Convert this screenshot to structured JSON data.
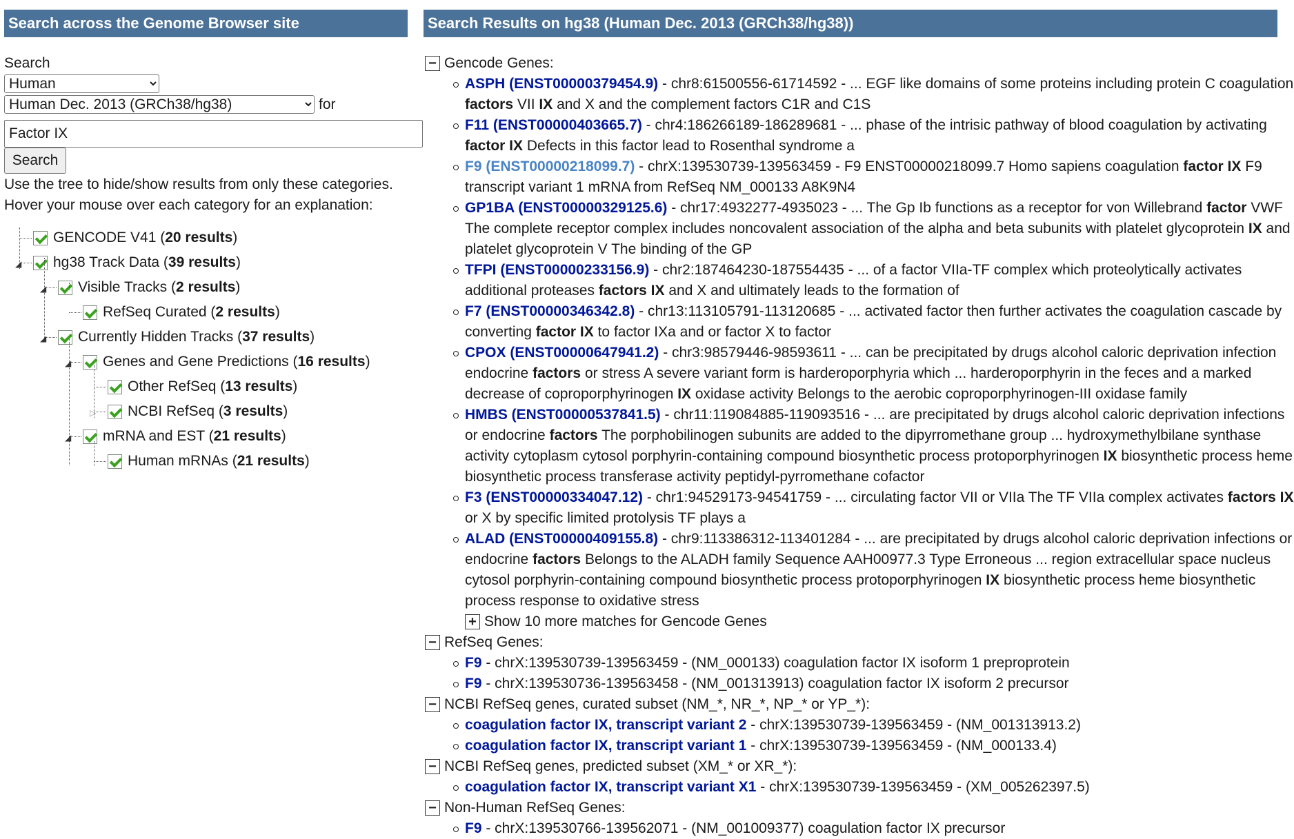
{
  "left_panel": {
    "header": "Search across the Genome Browser site",
    "search_label": "Search",
    "genome_select": "Human",
    "assembly_select": "Human Dec. 2013 (GRCh38/hg38)",
    "for_label": "for",
    "query_value": "Factor IX",
    "search_button": "Search",
    "help_line1": "Use the tree to hide/show results from only these categories.",
    "help_line2": "Hover your mouse over each category for an explanation:",
    "tree": [
      {
        "label": "GENCODE V41",
        "count": "20 results"
      },
      {
        "label": "hg38 Track Data",
        "count": "39 results"
      },
      {
        "label": "Visible Tracks",
        "count": "2 results"
      },
      {
        "label": "RefSeq Curated",
        "count": "2 results"
      },
      {
        "label": "Currently Hidden Tracks",
        "count": "37 results"
      },
      {
        "label": "Genes and Gene Predictions",
        "count": "16 results"
      },
      {
        "label": "Other RefSeq",
        "count": "13 results"
      },
      {
        "label": "NCBI RefSeq",
        "count": "3 results"
      },
      {
        "label": "mRNA and EST",
        "count": "21 results"
      },
      {
        "label": "Human mRNAs",
        "count": "21 results"
      }
    ]
  },
  "right_panel": {
    "header": "Search Results on hg38 (Human Dec. 2013 (GRCh38/hg38))",
    "categories": [
      {
        "title": "Gencode Genes:",
        "results": [
          {
            "link": "ASPH (ENST00000379454.9)",
            "rest_html": " - chr8:61500556-61714592 - ... EGF like domains of some proteins including protein C coagulation <b class=\"k\">factors</b> VII <b class=\"k\">IX</b> and X and the complement factors C1R and C1S"
          },
          {
            "link": "F11 (ENST00000403665.7)",
            "rest_html": " - chr4:186266189-186289681 - ... phase of the intrisic pathway of blood coagulation by activating <b class=\"k\">factor IX</b> Defects in this factor lead to Rosenthal syndrome a"
          },
          {
            "link": "F9 (ENST00000218099.7)",
            "visited": true,
            "rest_html": " - chrX:139530739-139563459 - F9 ENST00000218099.7 Homo sapiens coagulation <b class=\"k\">factor IX</b> F9 transcript variant 1 mRNA from RefSeq NM_000133 A8K9N4"
          },
          {
            "link": "GP1BA (ENST00000329125.6)",
            "rest_html": " - chr17:4932277-4935023 - ... The Gp Ib functions as a receptor for von Willebrand <b class=\"k\">factor</b> VWF The complete receptor complex includes noncovalent association of the alpha and beta subunits with platelet glycoprotein <b class=\"k\">IX</b> and platelet glycoprotein V The binding of the GP"
          },
          {
            "link": "TFPI (ENST00000233156.9)",
            "rest_html": " - chr2:187464230-187554435 - ... of a factor VIIa-TF complex which proteolytically activates additional proteases <b class=\"k\">factors IX</b> and X and ultimately leads to the formation of"
          },
          {
            "link": "F7 (ENST00000346342.8)",
            "rest_html": " - chr13:113105791-113120685 - ... activated factor then further activates the coagulation cascade by converting <b class=\"k\">factor IX</b> to factor IXa and or factor X to factor"
          },
          {
            "link": "CPOX (ENST00000647941.2)",
            "rest_html": " - chr3:98579446-98593611 - ... can be precipitated by drugs alcohol caloric deprivation infection endocrine <b class=\"k\">factors</b> or stress A severe variant form is harderoporphyria which ... harderoporphyrin in the feces and a marked decrease of coproporphyrinogen <b class=\"k\">IX</b> oxidase activity Belongs to the aerobic coproporphyrinogen-III oxidase family"
          },
          {
            "link": "HMBS (ENST00000537841.5)",
            "rest_html": " - chr11:119084885-119093516 - ... are precipitated by drugs alcohol caloric deprivation infections or endocrine <b class=\"k\">factors</b> The porphobilinogen subunits are added to the dipyrromethane group ... hydroxymethylbilane synthase activity cytoplasm cytosol porphyrin-containing compound biosynthetic process protoporphyrinogen <b class=\"k\">IX</b> biosynthetic process heme biosynthetic process transferase activity peptidyl-pyrromethane cofactor"
          },
          {
            "link": "F3 (ENST00000334047.12)",
            "rest_html": " - chr1:94529173-94541759 - ... circulating factor VII or VIIa The TF VIIa complex activates <b class=\"k\">factors IX</b> or X by specific limited protolysis TF plays a"
          },
          {
            "link": "ALAD (ENST00000409155.8)",
            "rest_html": " - chr9:113386312-113401284 - ... are precipitated by drugs alcohol caloric deprivation infections or endocrine <b class=\"k\">factors</b> Belongs to the ALADH family Sequence AAH00977.3 Type Erroneous ... region extracellular space nucleus cytosol porphyrin-containing compound biosynthetic process protoporphyrinogen <b class=\"k\">IX</b> biosynthetic process heme biosynthetic process response to oxidative stress"
          }
        ],
        "more": "Show 10 more matches for Gencode Genes"
      },
      {
        "title": "RefSeq Genes:",
        "results": [
          {
            "link": "F9",
            "rest_html": " - chrX:139530739-139563459 - (NM_000133) coagulation factor IX isoform 1 preproprotein"
          },
          {
            "link": "F9",
            "rest_html": " - chrX:139530736-139563458 - (NM_001313913) coagulation factor IX isoform 2 precursor"
          }
        ]
      },
      {
        "title": "NCBI RefSeq genes, curated subset (NM_*, NR_*, NP_* or YP_*):",
        "results": [
          {
            "link": "coagulation factor IX, transcript variant 2",
            "rest_html": " - chrX:139530739-139563459 - (NM_001313913.2)"
          },
          {
            "link": "coagulation factor IX, transcript variant 1",
            "rest_html": " - chrX:139530739-139563459 - (NM_000133.4)"
          }
        ]
      },
      {
        "title": "NCBI RefSeq genes, predicted subset (XM_* or XR_*):",
        "results": [
          {
            "link": "coagulation factor IX, transcript variant X1",
            "rest_html": " - chrX:139530739-139563459 - (XM_005262397.5)"
          }
        ]
      },
      {
        "title": "Non-Human RefSeq Genes:",
        "results": [
          {
            "link": "F9",
            "rest_html": " - chrX:139530766-139562071 - (NM_001009377) coagulation factor IX precursor"
          }
        ]
      }
    ]
  }
}
